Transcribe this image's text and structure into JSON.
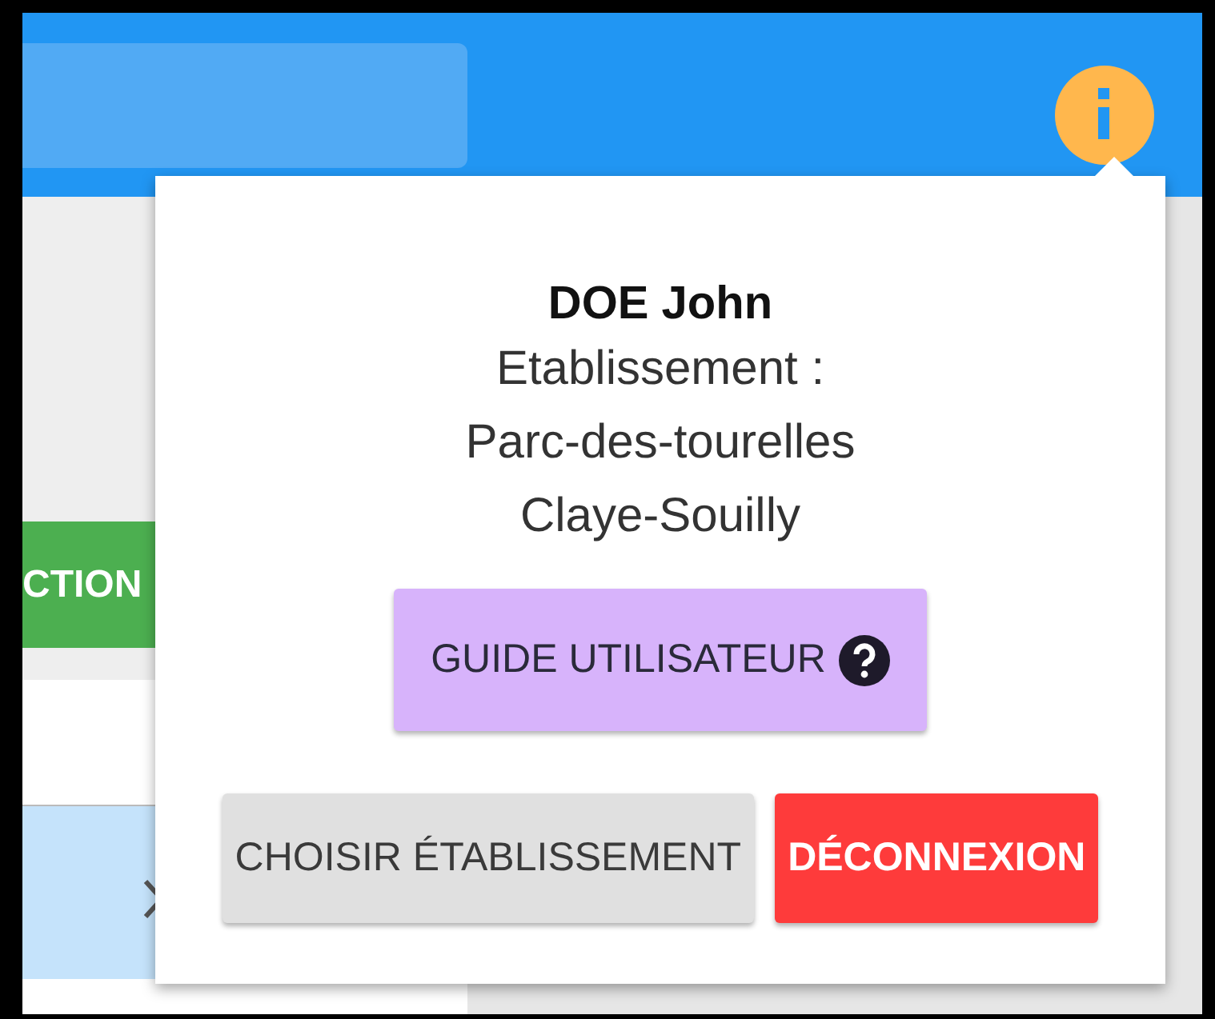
{
  "left_panel": {
    "action_button": {
      "label": "CTION"
    }
  },
  "user_popup": {
    "user_name": "DOE John",
    "lines": [
      "Etablissement :",
      "Parc-des-tourelles",
      "Claye-Souilly"
    ],
    "guide_button": {
      "label": "GUIDE UTILISATEUR"
    },
    "buttons": [
      {
        "label": "CHOISIR ÉTABLISSEMENT",
        "kind": "secondary"
      },
      {
        "label": "DÉCONNEXION",
        "kind": "danger"
      }
    ]
  }
}
